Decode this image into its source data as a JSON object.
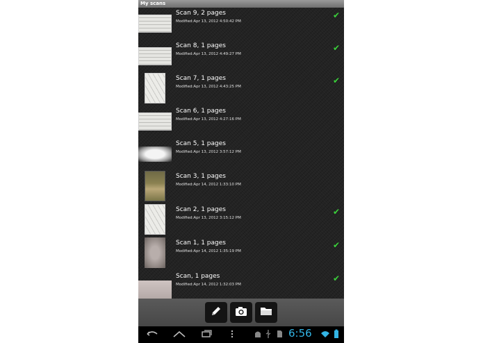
{
  "app": {
    "title": "My scans"
  },
  "scans": [
    {
      "title": "Scan 9, 2 pages",
      "modified": "Modified:Apr 13, 2012 4:50:42 PM",
      "checked": true
    },
    {
      "title": "Scan 8, 1 pages",
      "modified": "Modified:Apr 13, 2012 4:49:27 PM",
      "checked": true
    },
    {
      "title": "Scan 7, 1 pages",
      "modified": "Modified:Apr 13, 2012 4:43:25 PM",
      "checked": true
    },
    {
      "title": "Scan 6, 1 pages",
      "modified": "Modified:Apr 13, 2012 4:27:16 PM",
      "checked": false
    },
    {
      "title": "Scan 5, 1 pages",
      "modified": "Modified:Apr 13, 2012 3:57:12 PM",
      "checked": false
    },
    {
      "title": "Scan 3, 1 pages",
      "modified": "Modified:Apr 14, 2012 1:33:10 PM",
      "checked": false
    },
    {
      "title": "Scan 2, 1 pages",
      "modified": "Modified:Apr 13, 2012 3:15:12 PM",
      "checked": true
    },
    {
      "title": "Scan 1, 1 pages",
      "modified": "Modified:Apr 14, 2012 1:35:19 PM",
      "checked": true
    },
    {
      "title": "Scan, 1 pages",
      "modified": "Modified:Apr 14, 2012 1:32:03 PM",
      "checked": true
    }
  ],
  "toolbar": {
    "buttons": [
      {
        "name": "edit-button",
        "icon": "pencil-icon"
      },
      {
        "name": "camera-button",
        "icon": "camera-icon"
      },
      {
        "name": "folder-button",
        "icon": "folder-icon"
      }
    ]
  },
  "status": {
    "time": "6:56",
    "accent": "#33b5e5",
    "check_color": "#3ad13a"
  }
}
